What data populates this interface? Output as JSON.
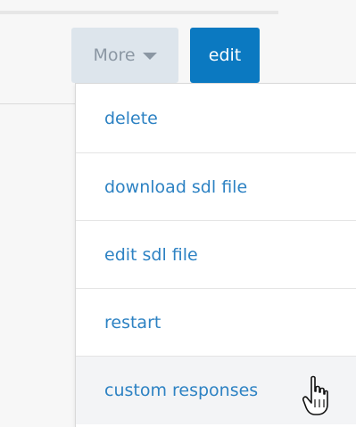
{
  "toolbar": {
    "more_label": "More",
    "edit_label": "edit"
  },
  "menu": {
    "items": [
      {
        "label": "delete"
      },
      {
        "label": "download sdl file"
      },
      {
        "label": "edit sdl file"
      },
      {
        "label": "restart"
      },
      {
        "label": "custom responses"
      }
    ],
    "hovered_item": "custom responses"
  },
  "colors": {
    "primary": "#0b79c1",
    "link": "#2d82c3",
    "more_bg": "#dde5ec",
    "more_text": "#8b97a3"
  },
  "icons": {
    "dropdown_caret": "caret-down-icon",
    "pointer": "hand-pointer-cursor-icon"
  }
}
